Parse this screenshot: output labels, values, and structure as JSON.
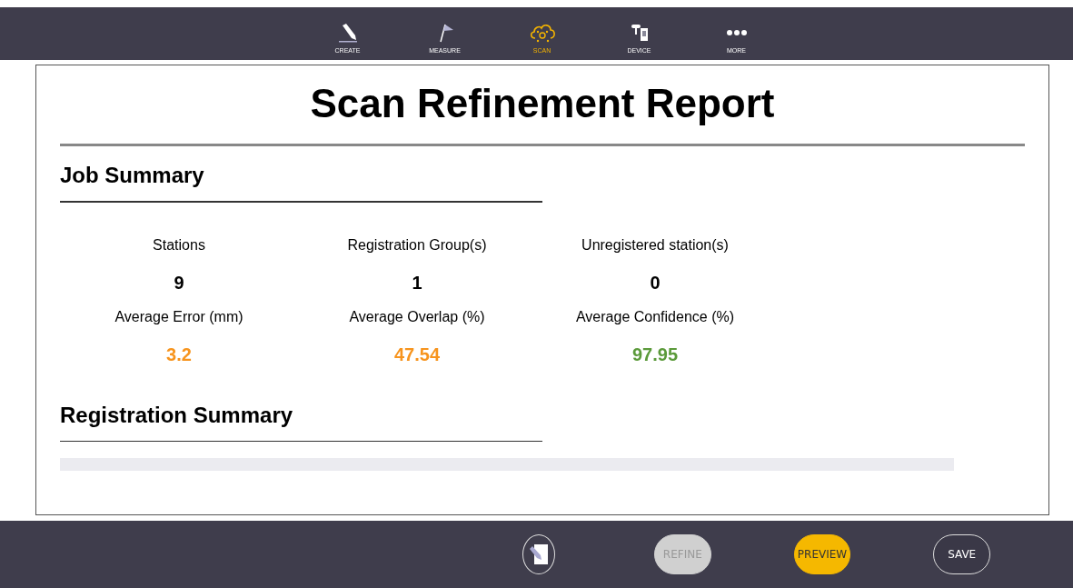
{
  "nav": [
    {
      "kind": "create",
      "label": "CREATE",
      "selected": false
    },
    {
      "kind": "measure",
      "label": "MEASURE",
      "selected": false
    },
    {
      "kind": "scan",
      "label": "SCAN",
      "selected": true
    },
    {
      "kind": "device",
      "label": "DEVICE",
      "selected": false
    },
    {
      "kind": "more",
      "label": "MORE",
      "selected": false
    }
  ],
  "report": {
    "title": "Scan Refinement Report",
    "job_summary": {
      "heading": "Job Summary",
      "stats": [
        {
          "label": "Stations",
          "value": "9",
          "color": "#000000"
        },
        {
          "label": "Registration Group(s)",
          "value": "1",
          "color": "#000000"
        },
        {
          "label": "Unregistered station(s)",
          "value": "0",
          "color": "#000000"
        },
        {
          "label": "Average Error (mm)",
          "value": "3.2",
          "color": "#f7941d"
        },
        {
          "label": "Average Overlap (%)",
          "value": "47.54",
          "color": "#f7941d"
        },
        {
          "label": "Average Confidence (%)",
          "value": "97.95",
          "color": "#5b9a3a"
        }
      ]
    },
    "registration_summary": {
      "heading": "Registration Summary"
    }
  },
  "actions": [
    {
      "kind": "edit-icon"
    },
    {
      "kind": "pill",
      "label": "REFINE",
      "disabled": true,
      "primary": false
    },
    {
      "kind": "pill",
      "label": "PREVIEW",
      "disabled": false,
      "primary": true
    },
    {
      "kind": "pill",
      "label": "SAVE",
      "disabled": false,
      "primary": false
    }
  ]
}
